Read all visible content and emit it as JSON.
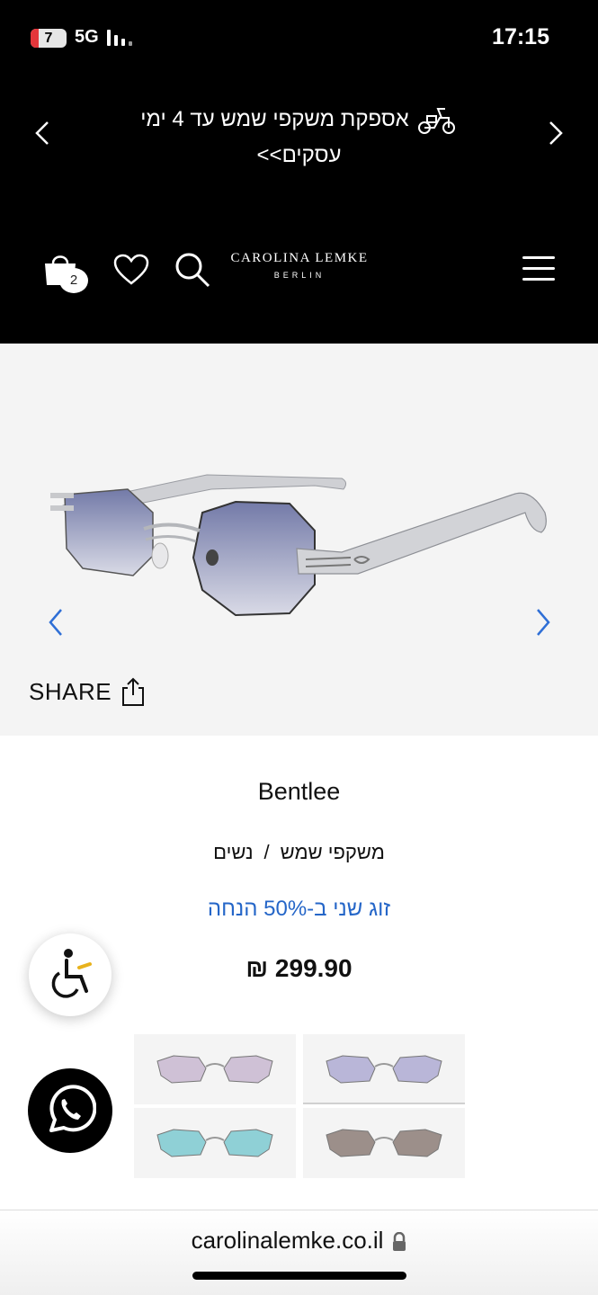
{
  "status_bar": {
    "battery": "7",
    "network": "5G",
    "time": "17:15"
  },
  "promo": {
    "text": "אספקת משקפי שמש עד 4 ימי עסקים>>",
    "icon": "scooter-icon"
  },
  "header": {
    "cart_count": "2",
    "brand": "CAROLINA LEMKE",
    "city": "BERLIN"
  },
  "gallery": {
    "share_label": "SHARE"
  },
  "product": {
    "name": "Bentlee",
    "category": "משקפי שמש",
    "separator": "/",
    "gender": "נשים",
    "offer": "זוג שני ב-50% הנחה",
    "price": "₪ 299.90"
  },
  "variants": [
    {
      "lens": "#b9b6d8",
      "selected": true
    },
    {
      "lens": "#cfc1d6",
      "selected": false
    },
    {
      "lens": "#9c8f8a",
      "selected": false
    },
    {
      "lens": "#8fd0d6",
      "selected": false
    }
  ],
  "browser": {
    "url": "carolinalemke.co.il"
  },
  "colors": {
    "header_bg": "#000000",
    "offer_blue": "#2566c8",
    "chevron_blue": "#2f6fd6"
  }
}
